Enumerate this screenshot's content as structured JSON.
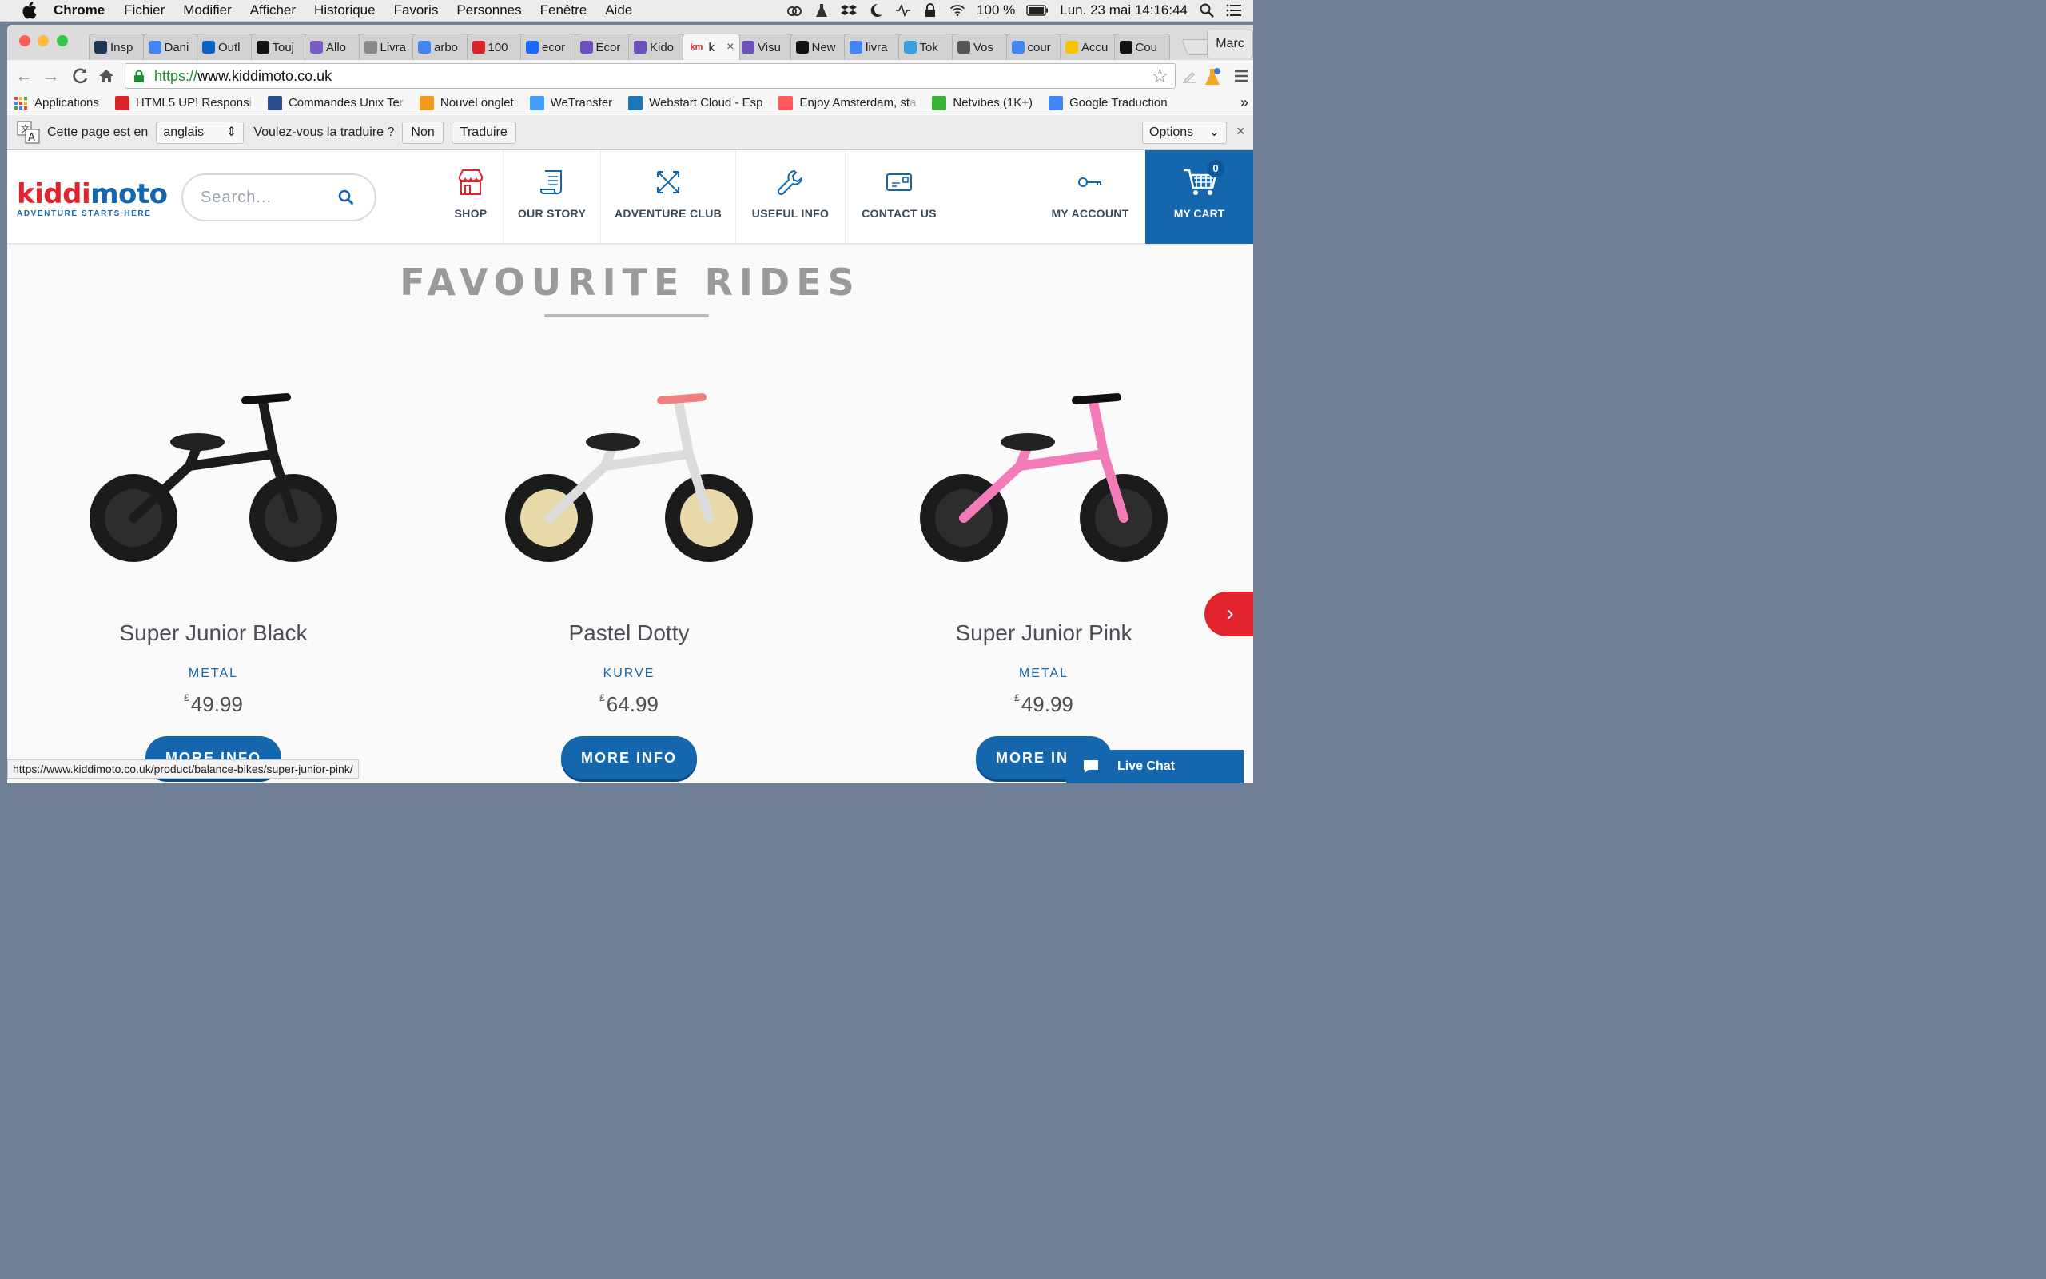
{
  "menubar": {
    "app": "Chrome",
    "items": [
      "Fichier",
      "Modifier",
      "Afficher",
      "Historique",
      "Favoris",
      "Personnes",
      "Fenêtre",
      "Aide"
    ],
    "battery": "100 %",
    "clock": "Lun. 23 mai  14:16:44"
  },
  "browser": {
    "tabs": [
      {
        "label": "Insp",
        "fav_color": "#1d3557"
      },
      {
        "label": "Dani",
        "fav_color": "#4285f4"
      },
      {
        "label": "Outl",
        "fav_color": "#0a64c8"
      },
      {
        "label": "Touj",
        "fav_color": "#111111"
      },
      {
        "label": "Allo",
        "fav_color": "#7a5cc8"
      },
      {
        "label": "Livra",
        "fav_color": "#888888"
      },
      {
        "label": "arbo",
        "fav_color": "#4285f4"
      },
      {
        "label": "100",
        "fav_color": "#d8232a"
      },
      {
        "label": "ecor",
        "fav_color": "#1769ff"
      },
      {
        "label": "Ecor",
        "fav_color": "#6b4fbb"
      },
      {
        "label": "Kido",
        "fav_color": "#6b4fbb"
      },
      {
        "label": "k",
        "fav_color": "#e1242d"
      },
      {
        "label": "Visu",
        "fav_color": "#6b4fbb"
      },
      {
        "label": "New",
        "fav_color": "#111111"
      },
      {
        "label": "livra",
        "fav_color": "#4285f4"
      },
      {
        "label": "Tok",
        "fav_color": "#3aa0e6"
      },
      {
        "label": "Vos",
        "fav_color": "#555555"
      },
      {
        "label": "cour",
        "fav_color": "#4285f4"
      },
      {
        "label": "Accu",
        "fav_color": "#f5c400"
      },
      {
        "label": "Cou",
        "fav_color": "#111111"
      }
    ],
    "active_tab_fav_text": "km",
    "profile": "Marc",
    "url_protocol": "https://",
    "url_host": "www.kiddimoto.co.uk",
    "bookmarks": [
      {
        "label": "Applications",
        "fade": "",
        "color": "#e94235"
      },
      {
        "label": "HTML5 UP! Respons",
        "fade": "i",
        "color": "#d8232a"
      },
      {
        "label": "Commandes Unix Te",
        "fade": "r",
        "color": "#2b4f8c"
      },
      {
        "label": "Nouvel onglet",
        "fade": "",
        "color": "#f29a1f"
      },
      {
        "label": "WeTransfer",
        "fade": "",
        "color": "#409fff"
      },
      {
        "label": "Webstart Cloud - Esp",
        "fade": "",
        "color": "#1b75bb"
      },
      {
        "label": "Enjoy Amsterdam, st",
        "fade": "a",
        "color": "#ff5a5f"
      },
      {
        "label": "Netvibes (1K+)",
        "fade": "",
        "color": "#3ab339"
      },
      {
        "label": "Google Traduction",
        "fade": "",
        "color": "#4285f4"
      }
    ],
    "bookmarks_more": "»"
  },
  "translate": {
    "prefix": "Cette page est en",
    "language": "anglais",
    "question": "Voulez-vous la traduire ?",
    "no": "Non",
    "yes": "Traduire",
    "options": "Options",
    "close": "×"
  },
  "site": {
    "logo_kid": "kiddi",
    "logo_moto": "moto",
    "tagline": "ADVENTURE STARTS HERE",
    "search_placeholder": "Search...",
    "nav": [
      "SHOP",
      "OUR STORY",
      "ADVENTURE CLUB",
      "USEFUL INFO",
      "CONTACT US",
      "MY ACCOUNT"
    ],
    "cart_label": "MY CART",
    "cart_count": "0",
    "section_title": "FAVOURITE RIDES",
    "next": "›",
    "products": [
      {
        "name": "Super Junior Black",
        "brand": "METAL",
        "currency": "£",
        "price": "49.99",
        "button": "MORE INFO",
        "bike_color": "#1c1c1c"
      },
      {
        "name": "Pastel Dotty",
        "brand": "KURVE",
        "currency": "£",
        "price": "64.99",
        "button": "MORE INFO",
        "bike_color": "#f4f4f4"
      },
      {
        "name": "Super Junior Pink",
        "brand": "METAL",
        "currency": "£",
        "price": "49.99",
        "button": "MORE INFO",
        "bike_color": "#f27bb8"
      }
    ]
  },
  "status_url": "https://www.kiddimoto.co.uk/product/balance-bikes/super-junior-pink/",
  "live_chat": "Live Chat"
}
